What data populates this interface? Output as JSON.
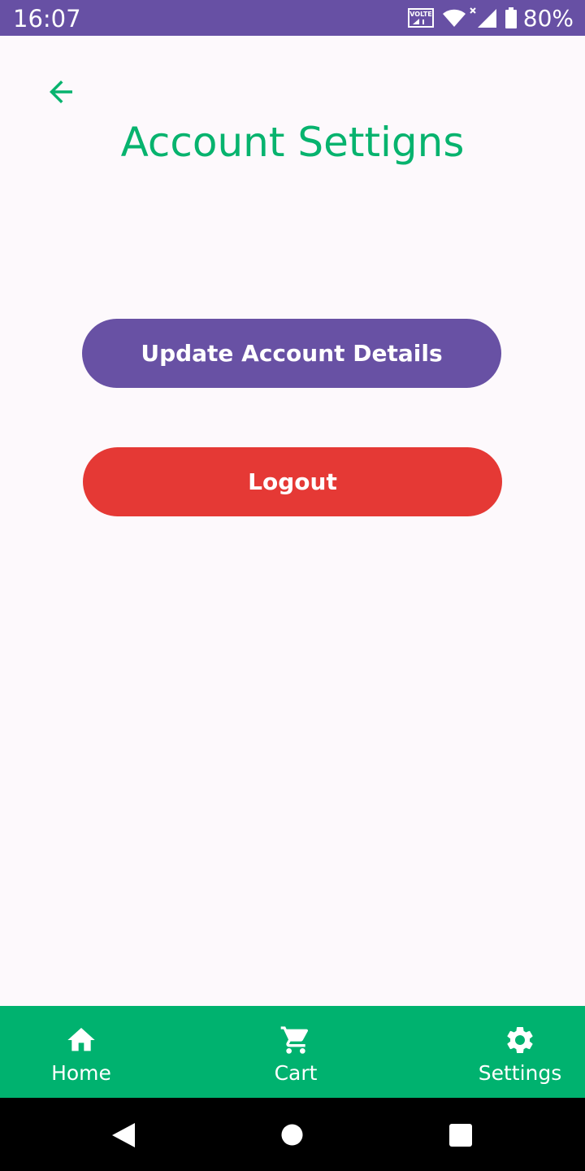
{
  "status_bar": {
    "time": "16:07",
    "battery_level": "80%",
    "volte_label": "VOLTE",
    "icons": [
      "volte-icon",
      "wifi-icon",
      "signal-icon",
      "battery-icon"
    ],
    "background_color": "#6750a4"
  },
  "header": {
    "back_icon": "arrow-back-icon",
    "title": "Account Settigns",
    "title_color": "#07b36e"
  },
  "actions": {
    "update_label": "Update Account Details",
    "update_color": "#6851a4",
    "logout_label": "Logout",
    "logout_color": "#e53935"
  },
  "bottom_nav": {
    "background_color": "#00b26f",
    "items": [
      {
        "label": "Home",
        "icon": "home-icon"
      },
      {
        "label": "Cart",
        "icon": "cart-icon"
      },
      {
        "label": "Settings",
        "icon": "gear-icon"
      }
    ]
  },
  "system_nav": {
    "icons": [
      "back-triangle-icon",
      "home-circle-icon",
      "recents-square-icon"
    ]
  }
}
